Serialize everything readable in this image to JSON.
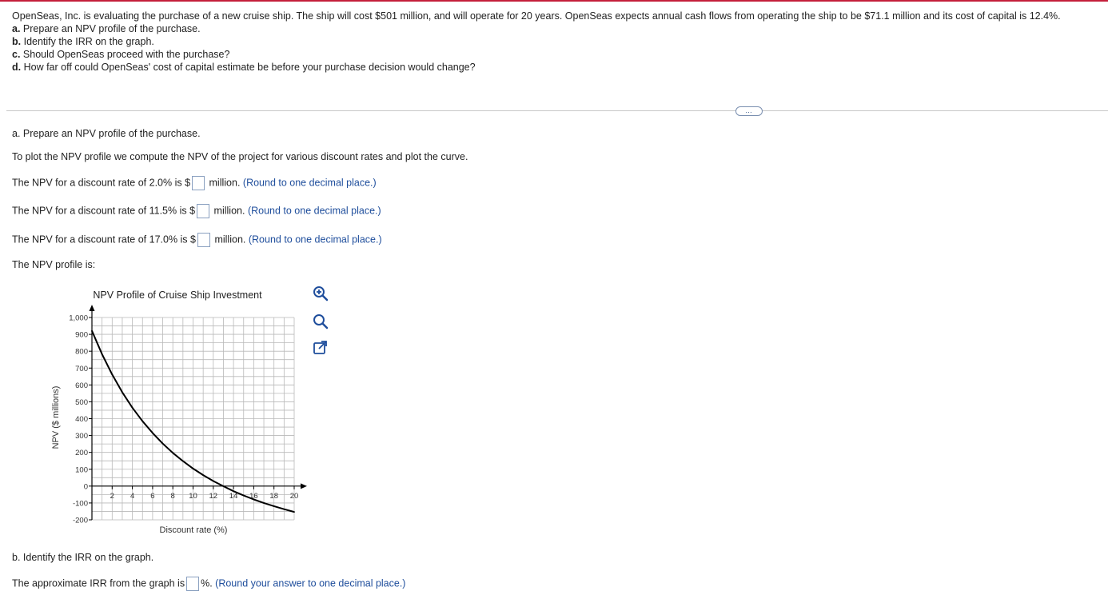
{
  "question": {
    "intro": "OpenSeas, Inc. is evaluating the purchase of a new cruise ship. The ship will cost $501 million, and will operate for 20 years. OpenSeas expects annual cash flows from operating the ship to be $71.1 million and its cost of capital is 12.4%.",
    "parts": [
      {
        "label": "a.",
        "text": "Prepare an NPV profile of the purchase."
      },
      {
        "label": "b.",
        "text": "Identify the IRR on the graph."
      },
      {
        "label": "c.",
        "text": "Should OpenSeas proceed with the purchase?"
      },
      {
        "label": "d.",
        "text": "How far off could OpenSeas' cost of capital estimate be before your purchase decision would change?"
      }
    ]
  },
  "more_button": "…",
  "part_a": {
    "heading": "a. Prepare an NPV profile of the purchase.",
    "instruction": "To plot the NPV profile we compute the NPV of the project for various discount rates and plot the curve.",
    "rows": [
      {
        "prefix": "The NPV for a discount rate of 2.0% is $",
        "suffix": "million.",
        "hint": "(Round to one decimal place.)"
      },
      {
        "prefix": "The NPV for a discount rate of 11.5% is $",
        "suffix": "million.",
        "hint": "(Round to one decimal place.)"
      },
      {
        "prefix": "The NPV for a discount rate of 17.0% is $",
        "suffix": "million.",
        "hint": "(Round to one decimal place.)"
      }
    ],
    "profile_label": "The NPV profile is:"
  },
  "chart_data": {
    "type": "line",
    "title": "NPV Profile of Cruise Ship Investment",
    "xlabel": "Discount rate (%)",
    "ylabel": "NPV ($ millions)",
    "xlim": [
      0,
      20
    ],
    "ylim": [
      -200,
      1000
    ],
    "xticks": [
      2,
      4,
      6,
      8,
      10,
      12,
      14,
      16,
      18,
      20
    ],
    "yticks": [
      1000,
      900,
      800,
      700,
      600,
      500,
      400,
      300,
      200,
      100,
      0,
      -100,
      -200
    ],
    "ytick_labels": [
      "1,000",
      "900",
      "800",
      "700",
      "600",
      "500",
      "400",
      "300",
      "200",
      "100",
      "0",
      "-100",
      "-200"
    ],
    "grid": true,
    "series": [
      {
        "x": [
          0,
          1,
          2,
          3,
          4,
          5,
          6,
          7,
          8,
          9,
          10,
          11,
          12,
          13,
          14,
          15,
          16,
          17,
          18,
          19,
          20
        ],
        "values": [
          921,
          782,
          662,
          557,
          465,
          385,
          315,
          252,
          197,
          148,
          104,
          65,
          30,
          -1,
          -30,
          -56,
          -79,
          -100,
          -119,
          -137,
          -153
        ]
      }
    ]
  },
  "tools": {
    "zoom_in": "zoom-in-icon",
    "zoom_out": "zoom-out-icon",
    "popout": "popout-icon"
  },
  "part_b": {
    "heading": "b. Identify the IRR on the graph.",
    "prefix": "The approximate IRR from the graph is",
    "suffix": "%.",
    "hint": "(Round your answer to one decimal place.)"
  }
}
